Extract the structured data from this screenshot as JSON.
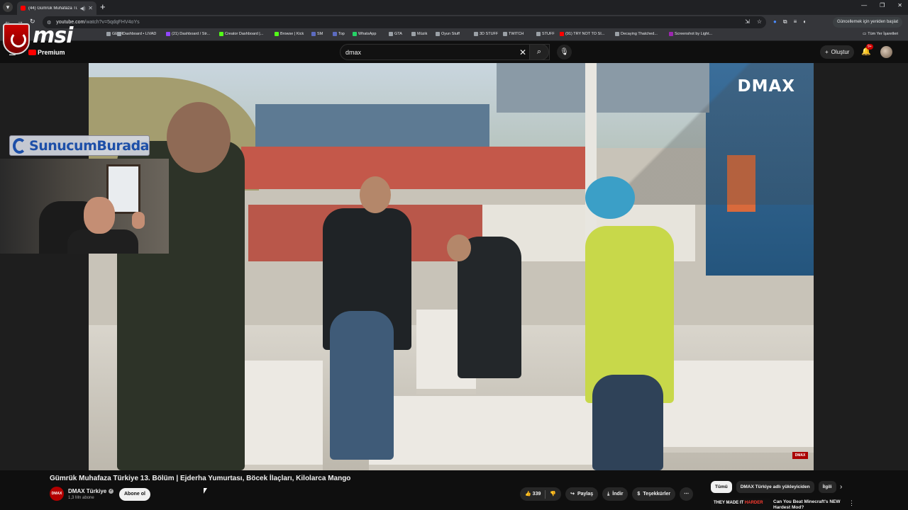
{
  "browser": {
    "tab_title": "(44) Gümrük Muhafaza Tür...",
    "url_host": "youtube.com",
    "url_path": "/watch?v=5qdqFHV4oYs",
    "update_button": "Güncellemek için yeniden başlat",
    "bookmarks": [
      {
        "label": "GEAR",
        "color": "#9aa0a6"
      },
      {
        "label": "Dashboard • LIVAD",
        "color": "#9aa0a6"
      },
      {
        "label": "(21) Dashboard / Str...",
        "color": "#9147ff"
      },
      {
        "label": "Creator Dashboard |...",
        "color": "#53fc18"
      },
      {
        "label": "Browse | Kick",
        "color": "#53fc18"
      },
      {
        "label": "SM",
        "color": "#5c6bc0"
      },
      {
        "label": "Top",
        "color": "#5c6bc0"
      },
      {
        "label": "WhatsApp",
        "color": "#25d366"
      },
      {
        "label": "GTA",
        "color": "#9aa0a6"
      },
      {
        "label": "Müzik",
        "color": "#9aa0a6"
      },
      {
        "label": "Oyun Stuff",
        "color": "#9aa0a6"
      },
      {
        "label": "3D STUFF",
        "color": "#9aa0a6"
      },
      {
        "label": "TWITCH",
        "color": "#9aa0a6"
      },
      {
        "label": "STUFF",
        "color": "#9aa0a6"
      },
      {
        "label": "(91) TRY NOT TO SI...",
        "color": "#ff0000"
      },
      {
        "label": "Decaying Thatched...",
        "color": "#9aa0a6"
      },
      {
        "label": "Screenshot by Light...",
        "color": "#9c27b0"
      }
    ],
    "all_bookmarks": "Tüm Yer İşaretleri"
  },
  "overlay": {
    "msi_text": "msi",
    "premium_label": "Premium",
    "cam_label": "SunucumBurada"
  },
  "masthead": {
    "search_value": "dmax",
    "create_label": "Oluştur",
    "notif_count": "9+"
  },
  "video": {
    "watermark": "DMAX",
    "corner_badge": "DMAX"
  },
  "info": {
    "title": "Gümrük Muhafaza Türkiye 13. Bölüm | Ejderha Yumurtası, Böcek İlaçları, Kilolarca Mango",
    "channel_avatar_text": "DMAX",
    "channel_name": "DMAX Türkiye",
    "subscribers": "1,3 Mn abone",
    "subscribe_label": "Abone ol",
    "like_count": "339",
    "share_label": "Paylaş",
    "download_label": "İndir",
    "thanks_label": "Teşekkürler"
  },
  "chips": [
    "Tümü",
    "DMAX Türkiye adlı yükleyiciden",
    "İlgili"
  ],
  "recommendation": {
    "thumb_text_a": "THEY MADE IT",
    "thumb_text_b": "HARDER",
    "title": "Can You Beat Minecraft's NEW Hardest Mod?"
  },
  "colors": {
    "accent": "#ff0000",
    "background": "#0f0f0f",
    "chip_bg": "#272727"
  }
}
